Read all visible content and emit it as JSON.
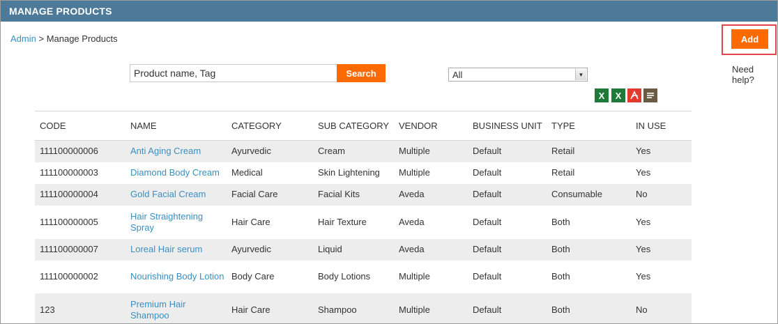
{
  "header": {
    "title": "MANAGE PRODUCTS"
  },
  "breadcrumb": {
    "root": "Admin",
    "separator": " > ",
    "current": "Manage Products"
  },
  "actions": {
    "add_label": "Add",
    "help_label": "Need help?"
  },
  "search": {
    "placeholder": "Product name, Tag",
    "button_label": "Search"
  },
  "filter": {
    "selected": "All"
  },
  "exports": [
    "excel-icon",
    "excel-icon",
    "pdf-icon",
    "text-icon"
  ],
  "table": {
    "columns": [
      "CODE",
      "NAME",
      "CATEGORY",
      "SUB CATEGORY",
      "VENDOR",
      "BUSINESS UNIT",
      "TYPE",
      "IN USE"
    ],
    "rows": [
      {
        "code": "111100000006",
        "name": "Anti Aging Cream",
        "category": "Ayurvedic",
        "sub_category": "Cream",
        "vendor": "Multiple",
        "business_unit": "Default",
        "type": "Retail",
        "in_use": "Yes"
      },
      {
        "code": "111100000003",
        "name": "Diamond Body Cream",
        "category": "Medical",
        "sub_category": "Skin Lightening",
        "vendor": "Multiple",
        "business_unit": "Default",
        "type": "Retail",
        "in_use": "Yes"
      },
      {
        "code": "111100000004",
        "name": "Gold Facial Cream",
        "category": "Facial Care",
        "sub_category": "Facial Kits",
        "vendor": "Aveda",
        "business_unit": "Default",
        "type": "Consumable",
        "in_use": "No"
      },
      {
        "code": "111100000005",
        "name": "Hair Straightening Spray",
        "category": "Hair Care",
        "sub_category": "Hair Texture",
        "vendor": "Aveda",
        "business_unit": "Default",
        "type": "Both",
        "in_use": "Yes"
      },
      {
        "code": "111100000007",
        "name": "Loreal Hair serum",
        "category": "Ayurvedic",
        "sub_category": "Liquid",
        "vendor": "Aveda",
        "business_unit": "Default",
        "type": "Both",
        "in_use": "Yes"
      },
      {
        "code": "111100000002",
        "name": "Nourishing Body Lotion",
        "category": "Body Care",
        "sub_category": "Body Lotions",
        "vendor": "Multiple",
        "business_unit": "Default",
        "type": "Both",
        "in_use": "Yes"
      },
      {
        "code": "123",
        "name": "Premium Hair Shampoo",
        "category": "Hair Care",
        "sub_category": "Shampoo",
        "vendor": "Multiple",
        "business_unit": "Default",
        "type": "Both",
        "in_use": "No"
      }
    ]
  },
  "colors": {
    "header_bg": "#4d7a99",
    "accent": "#ff6a00",
    "link": "#3a8fc0",
    "highlight_border": "#e5454a"
  }
}
